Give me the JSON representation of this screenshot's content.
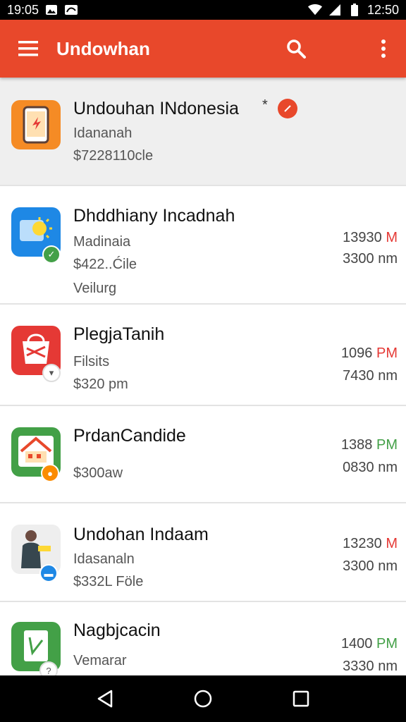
{
  "status_bar": {
    "left_time": "19:05",
    "clock": "12:50",
    "icons": [
      "image-notification-icon",
      "notification-icon",
      "wifi-icon",
      "signal-icon",
      "battery-icon"
    ]
  },
  "app_bar": {
    "title": "Undowhan",
    "icons": [
      "menu-icon",
      "search-icon",
      "more-vert-icon"
    ]
  },
  "items": [
    {
      "name": "Undouhan INdonesia",
      "star": "*",
      "line1": "Idananah",
      "line2": "$7228110cle",
      "colors": {
        "icon": "#f58b25",
        "badge": "#e8482b"
      }
    },
    {
      "name": "Dhddhiany Incadnah",
      "line1": "Madinaia",
      "line2": "$422..Ćile",
      "line3": "Veilurg",
      "time1_num": "13930",
      "time1_suffix": "M",
      "time2": "3300 nm",
      "colors": {
        "icon": "#1e88e5",
        "badge": "#43a047"
      }
    },
    {
      "name": "PlegjaTanih",
      "line1": "Filsits",
      "line2": "$320 pm",
      "time1_num": "1096",
      "time1_suffix": "PM",
      "time2": "7430 nm",
      "colors": {
        "icon": "#e53935",
        "badge": "#ffffff"
      }
    },
    {
      "name": "PrdanCandide",
      "line1": "$300aw",
      "time1_num": "1388",
      "time1_suffix": "PM",
      "time2": "0830 nm",
      "colors": {
        "icon": "#43a047",
        "badge": "#fb8c00"
      }
    },
    {
      "name": "Undohan Indaam",
      "line1": "Idasanaln",
      "line2": "$332L Föle",
      "time1_num": "13230",
      "time1_suffix": "M",
      "time2": "3300 nm",
      "colors": {
        "icon": "#eeeeee",
        "badge": "#1e88e5"
      }
    },
    {
      "name": "Nagbjcacin",
      "line1": "Vemarar",
      "time1_num": "1400",
      "time1_suffix": "PM",
      "time2": "3330 nm",
      "colors": {
        "icon": "#43a047",
        "badge": "#ffffff"
      }
    }
  ],
  "nav_bar": {
    "buttons": [
      "back-icon",
      "home-icon",
      "recents-icon"
    ]
  }
}
